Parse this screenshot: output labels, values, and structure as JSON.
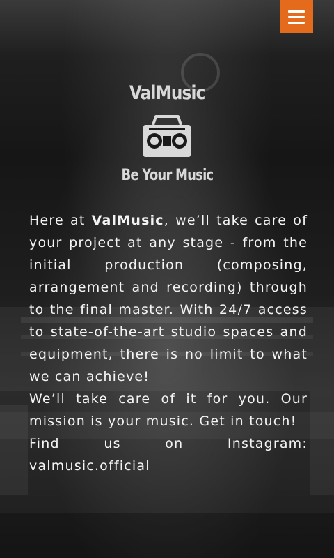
{
  "header": {
    "menu_icon": "hamburger-menu-icon",
    "menu_color": "#e36b1b"
  },
  "logo": {
    "name": "ValMusic",
    "icon": "boombox-icon",
    "tagline": "Be Your Music"
  },
  "content": {
    "p1_before": "Here at ",
    "p1_brand": "ValMusic",
    "p1_after": ", we’ll take care of your project at any stage - from the initial production (composing, arrangement and recording) through to the final master. With 24/7 access to state-of-the-art studio spaces and equipment, there is no limit to what we can achieve!",
    "p2": "We’ll take care of it for you. Our mission is your music. Get in touch!",
    "p3": "Find us on Instagram: valmusic.official"
  }
}
